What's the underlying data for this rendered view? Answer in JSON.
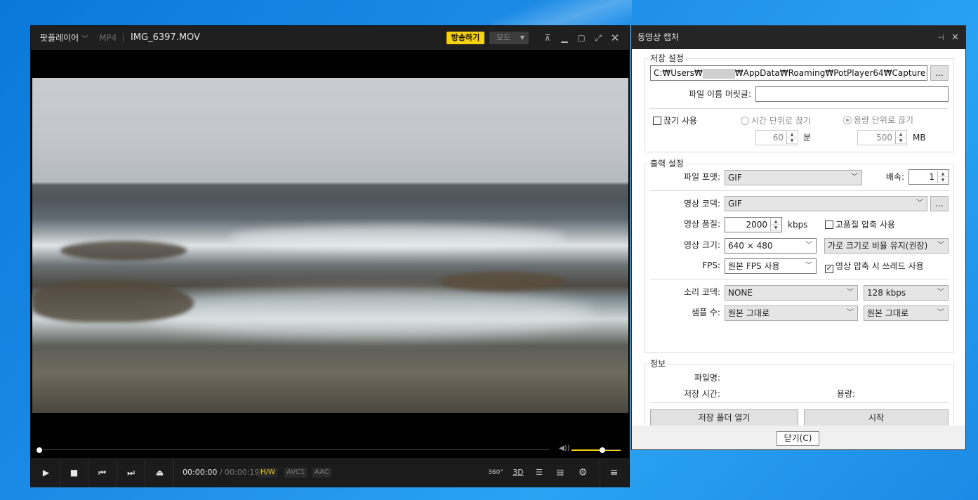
{
  "player": {
    "app_menu": "팟플레이어",
    "format": "MP4",
    "filename": "IMG_6397.MOV",
    "broadcast_label": "방송하기",
    "mode_label": "모드",
    "time_current": "00:00:00",
    "time_separator": "/",
    "time_total": "00:00:19",
    "tag_hw": "H/W",
    "tag_video": "AVC1",
    "tag_audio": "AAC",
    "icon_360": "360°",
    "icon_3d": "3D",
    "seek_fraction": 0.0,
    "volume_fraction": 0.75
  },
  "dialog": {
    "title": "동영상 캡처",
    "save": {
      "group_label": "저장 설정",
      "path": "C:₩Users₩",
      "path_rest": "₩AppData₩Roaming₩PotPlayer64₩Capture",
      "browse": "...",
      "prefix_label": "파일 이름 머릿글:",
      "prefix_value": "",
      "split_label": "끊기 사용",
      "split_checked": false,
      "by_time_label": "시간 단위로 끊기",
      "by_size_label": "용량 단위로 끊기",
      "time_value": "60",
      "time_unit": "분",
      "size_value": "500",
      "size_unit": "MB"
    },
    "output": {
      "group_label": "출력 설정",
      "file_format_label": "파일 포맷:",
      "file_format_value": "GIF",
      "speed_label": "배속:",
      "speed_value": "1",
      "video_codec_label": "영상 코덱:",
      "video_codec_value": "GIF",
      "codec_browse": "...",
      "quality_label": "영상 품질:",
      "quality_value": "2000",
      "quality_unit": "kbps",
      "hq_label": "고품질 압축 사용",
      "hq_checked": false,
      "size_label": "영상 크기:",
      "size_value": "640 × 480",
      "aspect_value": "가로 크기로 비율 유지(권장)",
      "fps_label": "FPS:",
      "fps_value": "원본 FPS 사용",
      "thread_label": "영상 압축 시 쓰레드 사용",
      "thread_checked": true,
      "audio_codec_label": "소리 코덱:",
      "audio_codec_value": "NONE",
      "audio_bitrate_value": "128 kbps",
      "sample_label": "샘플 수:",
      "sample_value": "원본 그대로",
      "channel_value": "원본 그대로"
    },
    "info": {
      "group_label": "정보",
      "filename_label": "파일명:",
      "save_time_label": "저장 시간:",
      "size_label": "용량:",
      "open_folder": "저장 폴더 열기",
      "start": "시작"
    },
    "close_button": "닫기(C)"
  }
}
